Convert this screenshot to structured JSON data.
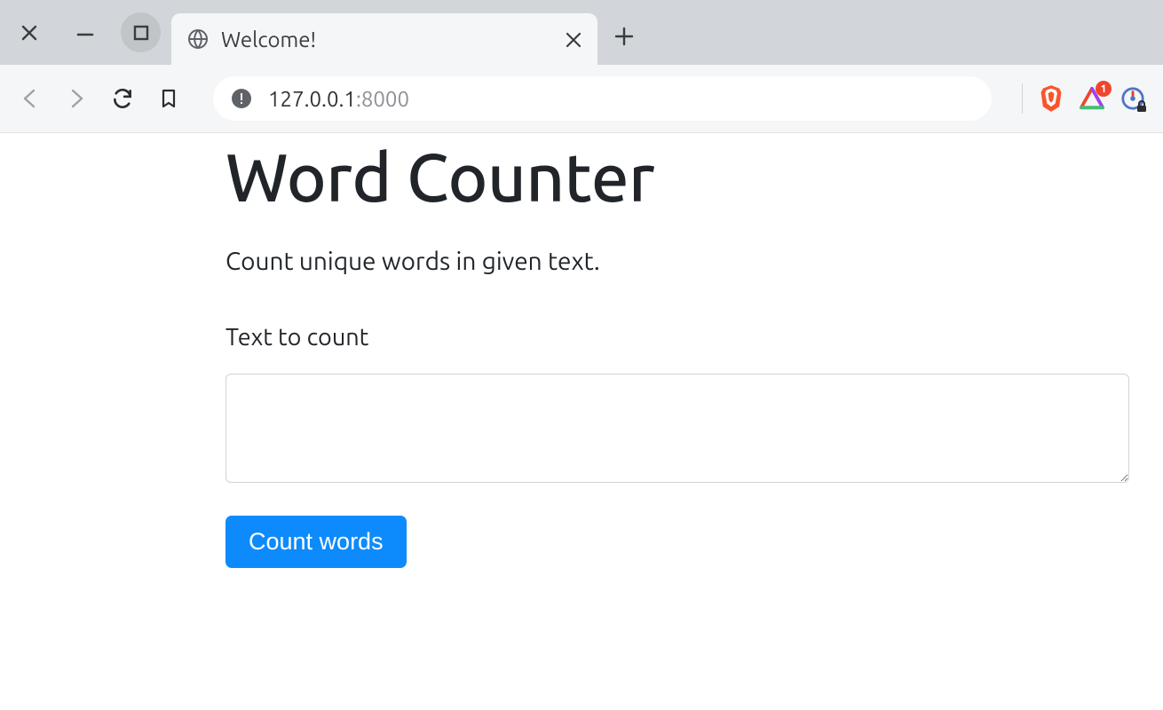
{
  "browser": {
    "tab_title": "Welcome!",
    "url_host": "127.0.0.1",
    "url_port": ":8000",
    "badge_count": "1"
  },
  "page": {
    "heading": "Word Counter",
    "lead": "Count unique words in given text.",
    "textarea_label": "Text to count",
    "textarea_value": "",
    "submit_label": "Count words"
  }
}
